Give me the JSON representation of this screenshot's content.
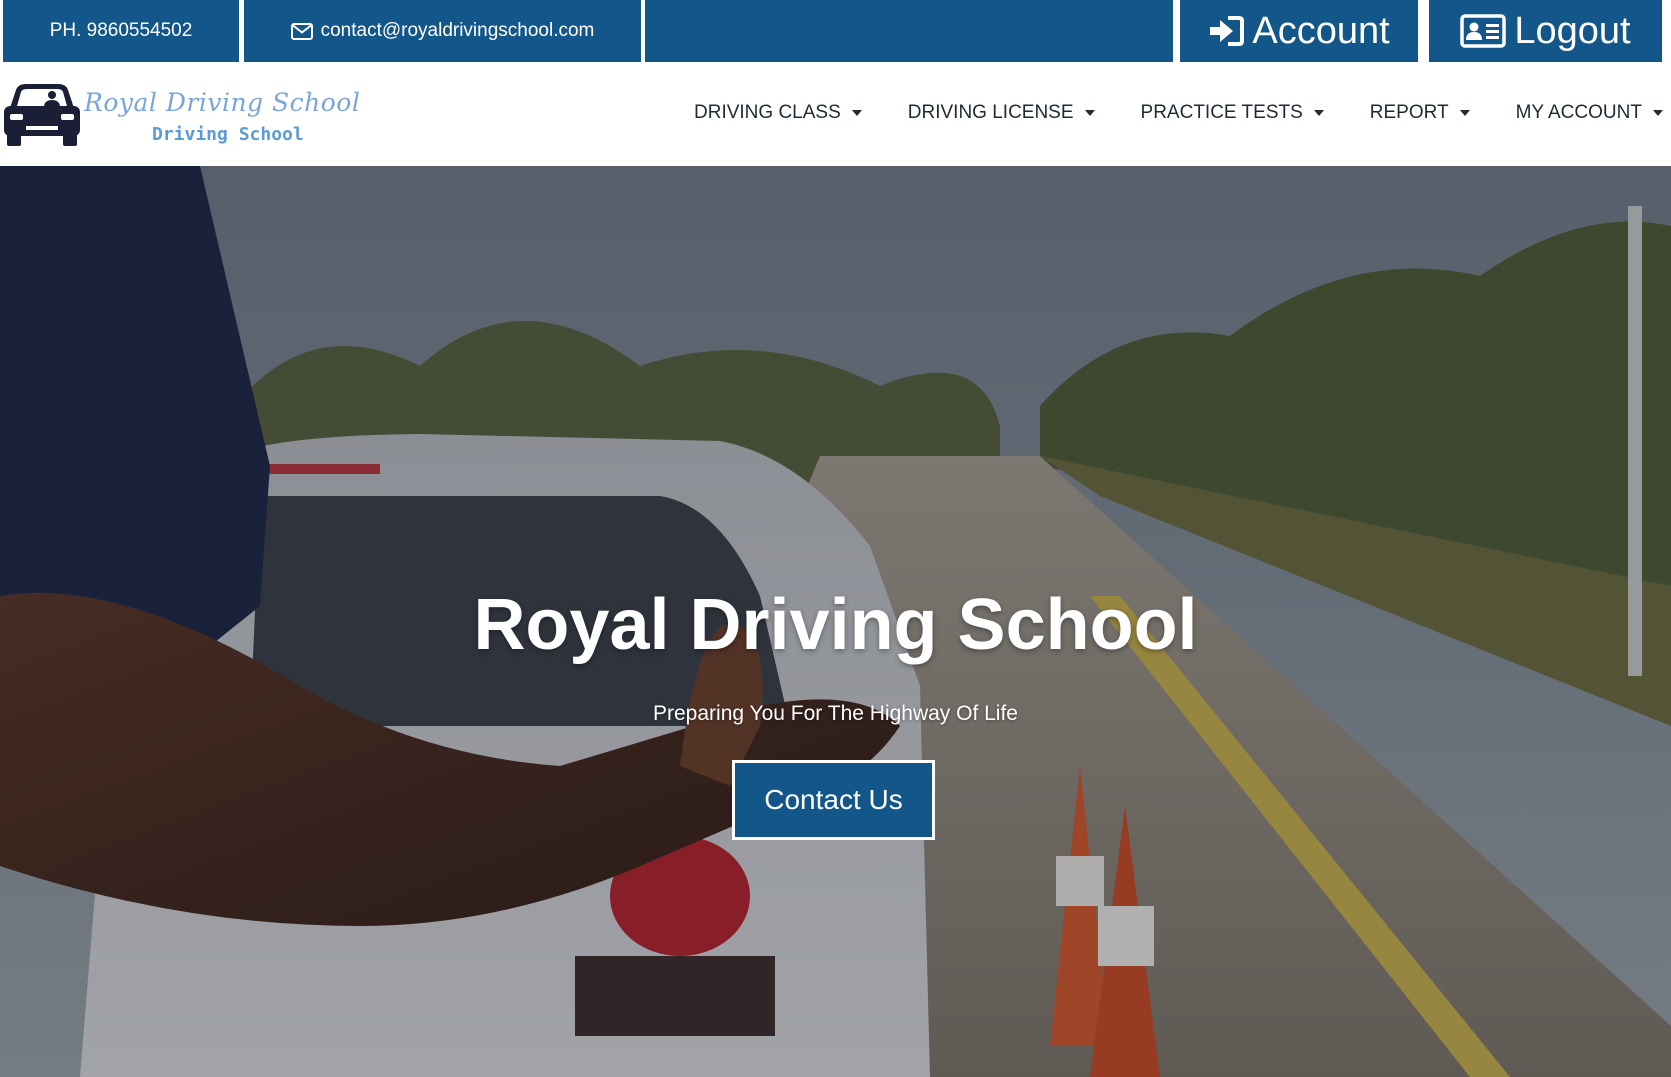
{
  "topbar": {
    "phone": "PH. 9860554502",
    "email": "contact@royaldrivingschool.com",
    "account_label": "Account",
    "logout_label": "Logout",
    "icons": [
      "envelope-icon",
      "sign-in-icon",
      "id-card-icon"
    ]
  },
  "brand": {
    "script_text": "Royal Driving School",
    "sub_text": "Driving School",
    "icon": "car-icon"
  },
  "nav": {
    "items": [
      {
        "label": "DRIVING CLASS"
      },
      {
        "label": "DRIVING LICENSE"
      },
      {
        "label": "PRACTICE TESTS"
      },
      {
        "label": "REPORT"
      },
      {
        "label": "MY ACCOUNT"
      }
    ]
  },
  "hero": {
    "title": "Royal Driving School",
    "subtitle": "Preparing You For The Highway Of Life",
    "button_label": "Contact Us"
  },
  "colors": {
    "primary": "#13578a",
    "nav_text": "#1f2a33",
    "logo_light": "#7aa5d8",
    "logo_dark": "#5b9bd5"
  }
}
